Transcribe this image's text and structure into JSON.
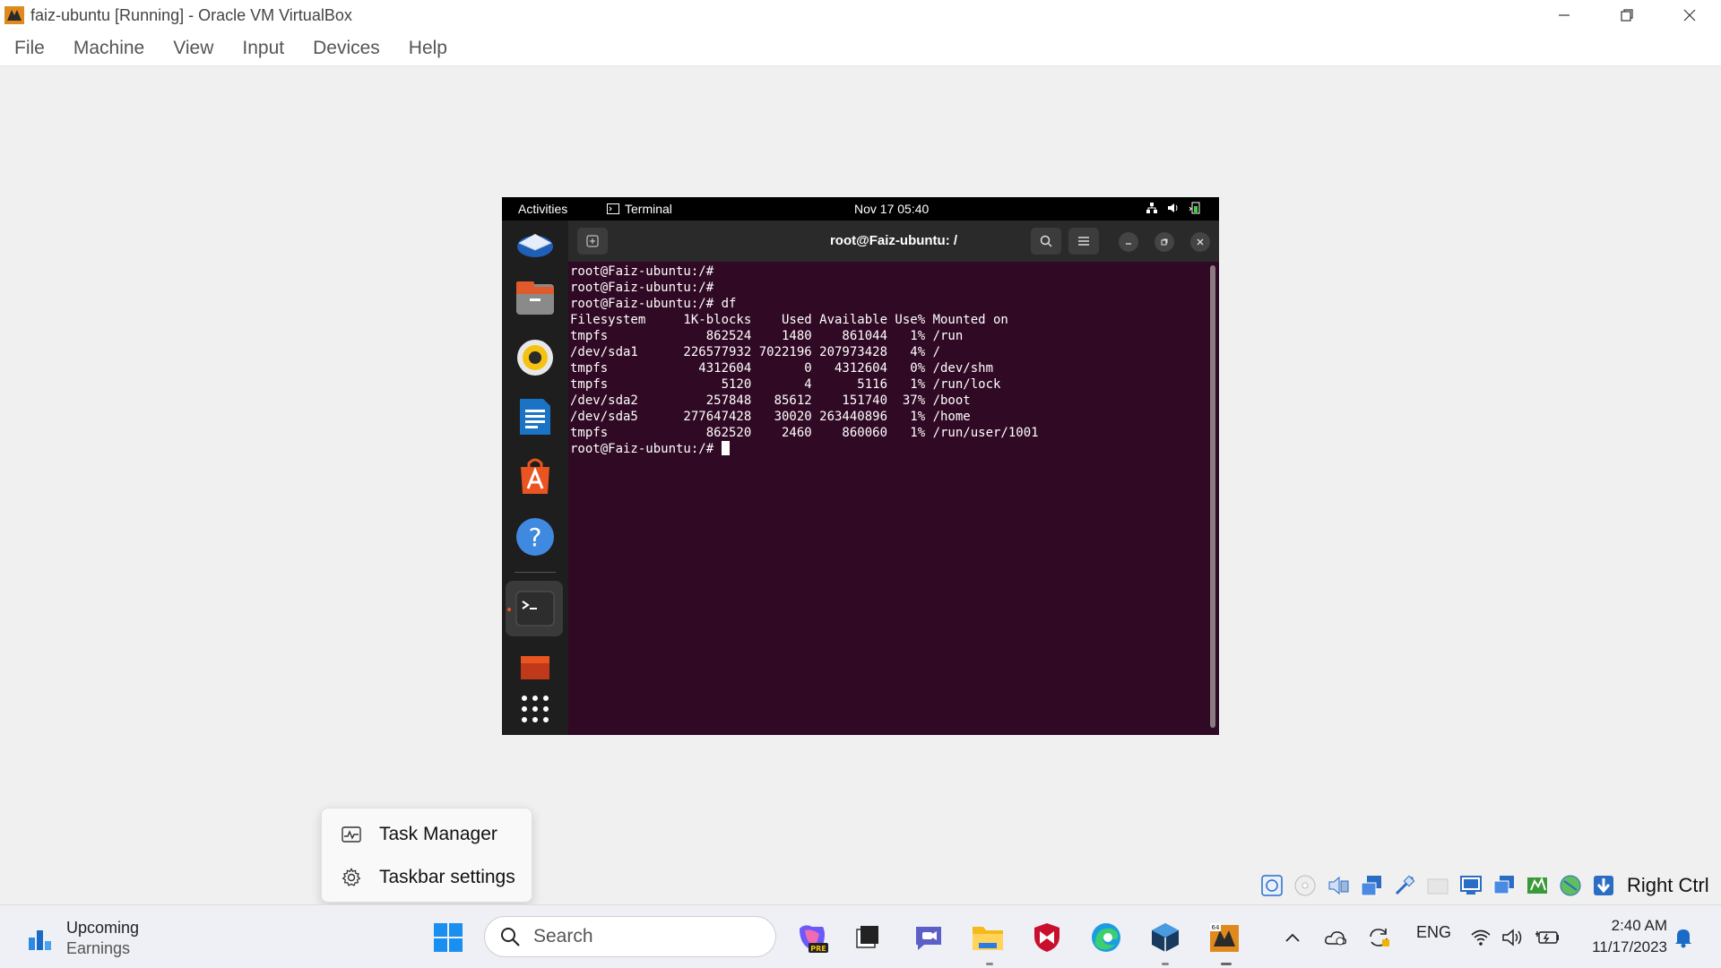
{
  "window": {
    "title": "faiz-ubuntu [Running] - Oracle VM VirtualBox"
  },
  "menu": [
    "File",
    "Machine",
    "View",
    "Input",
    "Devices",
    "Help"
  ],
  "gnome": {
    "activities": "Activities",
    "app": "Terminal",
    "clock": "Nov 17  05:40"
  },
  "terminal": {
    "title": "root@Faiz-ubuntu: /",
    "lines": [
      "root@Faiz-ubuntu:/#",
      "root@Faiz-ubuntu:/#",
      "root@Faiz-ubuntu:/# df",
      "Filesystem     1K-blocks    Used Available Use% Mounted on",
      "tmpfs             862524    1480    861044   1% /run",
      "/dev/sda1      226577932 7022196 207973428   4% /",
      "tmpfs            4312604       0   4312604   0% /dev/shm",
      "tmpfs               5120       4      5116   1% /run/lock",
      "/dev/sda2         257848   85612    151740  37% /boot",
      "/dev/sda5      277647428   30020 263440896   1% /home",
      "tmpfs             862520    2460    860060   1% /run/user/1001"
    ],
    "prompt": "root@Faiz-ubuntu:/# "
  },
  "context_menu": {
    "task_manager": "Task Manager",
    "taskbar_settings": "Taskbar settings"
  },
  "vbox_status": {
    "host_key": "Right Ctrl"
  },
  "taskbar": {
    "weather_line1": "Upcoming",
    "weather_line2": "Earnings",
    "search_placeholder": "Search",
    "lang": "ENG",
    "time": "2:40 AM",
    "date": "11/17/2023"
  }
}
